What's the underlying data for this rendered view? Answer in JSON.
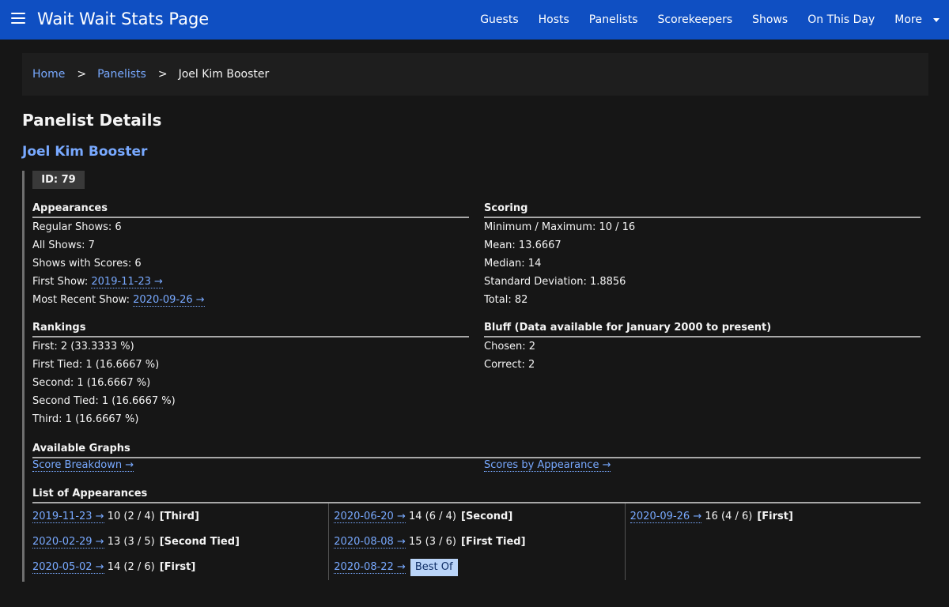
{
  "header": {
    "brand": "Wait Wait Stats Page",
    "nav": [
      "Guests",
      "Hosts",
      "Panelists",
      "Scorekeepers",
      "Shows",
      "On This Day"
    ],
    "more": "More"
  },
  "breadcrumb": {
    "home": "Home",
    "panelists": "Panelists",
    "current": "Joel Kim Booster",
    "separator": ">"
  },
  "page_title": "Panelist Details",
  "panelist_name": "Joel Kim Booster",
  "id_label": "ID: 79",
  "appearances": {
    "heading": "Appearances",
    "regular": "Regular Shows: 6",
    "all": "All Shows: 7",
    "with_scores": "Shows with Scores: 6",
    "first_label": "First Show: ",
    "first_link": "2019-11-23 →",
    "recent_label": "Most Recent Show: ",
    "recent_link": "2020-09-26 →"
  },
  "scoring": {
    "heading": "Scoring",
    "minmax": "Minimum / Maximum: 10 / 16",
    "mean": "Mean: 13.6667",
    "median": "Median: 14",
    "stddev": "Standard Deviation: 1.8856",
    "total": "Total: 82"
  },
  "rankings": {
    "heading": "Rankings",
    "first": "First: 2 (33.3333 %)",
    "first_tied": "First Tied: 1 (16.6667 %)",
    "second": "Second: 1 (16.6667 %)",
    "second_tied": "Second Tied: 1 (16.6667 %)",
    "third": "Third: 1 (16.6667 %)"
  },
  "bluff": {
    "heading": "Bluff (Data available for January 2000 to present)",
    "chosen": "Chosen: 2",
    "correct": "Correct: 2"
  },
  "graphs": {
    "heading": "Available Graphs",
    "score_breakdown": "Score Breakdown →",
    "scores_by_appearance": "Scores by Appearance →"
  },
  "list_of_appearances": {
    "heading": "List of Appearances",
    "items": [
      {
        "link": "2019-11-23 →",
        "score": " 10 (2 / 4)",
        "rank": "[Third]"
      },
      {
        "link": "2020-02-29 →",
        "score": " 13 (3 / 5)",
        "rank": "[Second Tied]"
      },
      {
        "link": "2020-05-02 →",
        "score": " 14 (2 / 6)",
        "rank": "[First]"
      },
      {
        "link": "2020-06-20 →",
        "score": " 14 (6 / 4)",
        "rank": "[Second]"
      },
      {
        "link": "2020-08-08 →",
        "score": " 15 (3 / 6)",
        "rank": "[First Tied]"
      },
      {
        "link": "2020-08-22 →",
        "badge": "Best Of"
      },
      {
        "link": "2020-09-26 →",
        "score": " 16 (4 / 6)",
        "rank": "[First]"
      }
    ]
  },
  "colors": {
    "topbar": "#0f4fc2",
    "background": "#161616",
    "link": "#78a9ff",
    "badge": "#bad4f8"
  }
}
